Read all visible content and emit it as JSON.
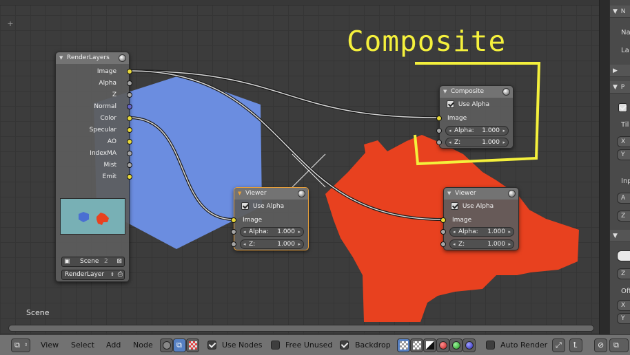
{
  "annotation": {
    "text": "Composite"
  },
  "editor": {
    "scene_label": "Scene"
  },
  "nodes": {
    "render_layers": {
      "title": "RenderLayers",
      "outputs": [
        "Image",
        "Alpha",
        "Z",
        "Normal",
        "Color",
        "Specular",
        "AO",
        "IndexMA",
        "Mist",
        "Emit"
      ],
      "scene_name": "Scene",
      "scene_users": "2",
      "layer_name": "RenderLayer"
    },
    "composite": {
      "title": "Composite",
      "use_alpha_label": "Use Alpha",
      "image_label": "Image",
      "alpha_label": "Alpha:",
      "alpha_value": "1.000",
      "z_label": "Z:",
      "z_value": "1.000"
    },
    "viewer_left": {
      "title": "Viewer",
      "use_alpha_label": "Use Alpha",
      "image_label": "Image",
      "alpha_label": "Alpha:",
      "alpha_value": "1.000",
      "z_label": "Z:",
      "z_value": "1.000"
    },
    "viewer_right": {
      "title": "Viewer",
      "use_alpha_label": "Use Alpha",
      "image_label": "Image",
      "alpha_label": "Alpha:",
      "alpha_value": "1.000",
      "z_label": "Z:",
      "z_value": "1.000"
    }
  },
  "properties": {
    "name_label": "Na",
    "layer_label": "La",
    "tile_label": "Til",
    "x_label": "X",
    "y_label": "Y",
    "input_label": "Inp",
    "a_label": "A",
    "z_label": "Z",
    "offset_label": "Off"
  },
  "header": {
    "menu": [
      "View",
      "Select",
      "Add",
      "Node"
    ],
    "use_nodes_label": "Use Nodes",
    "free_unused_label": "Free Unused",
    "backdrop_label": "Backdrop",
    "auto_render_label": "Auto Render"
  },
  "colors": {
    "annotation": "#f4f03c",
    "backdrop_hex": "#6b8de0",
    "backdrop_monkey": "#e8411f",
    "socket_color": "#e8d93a",
    "socket_value": "#a6a6a6",
    "socket_vector": "#6464c8"
  }
}
